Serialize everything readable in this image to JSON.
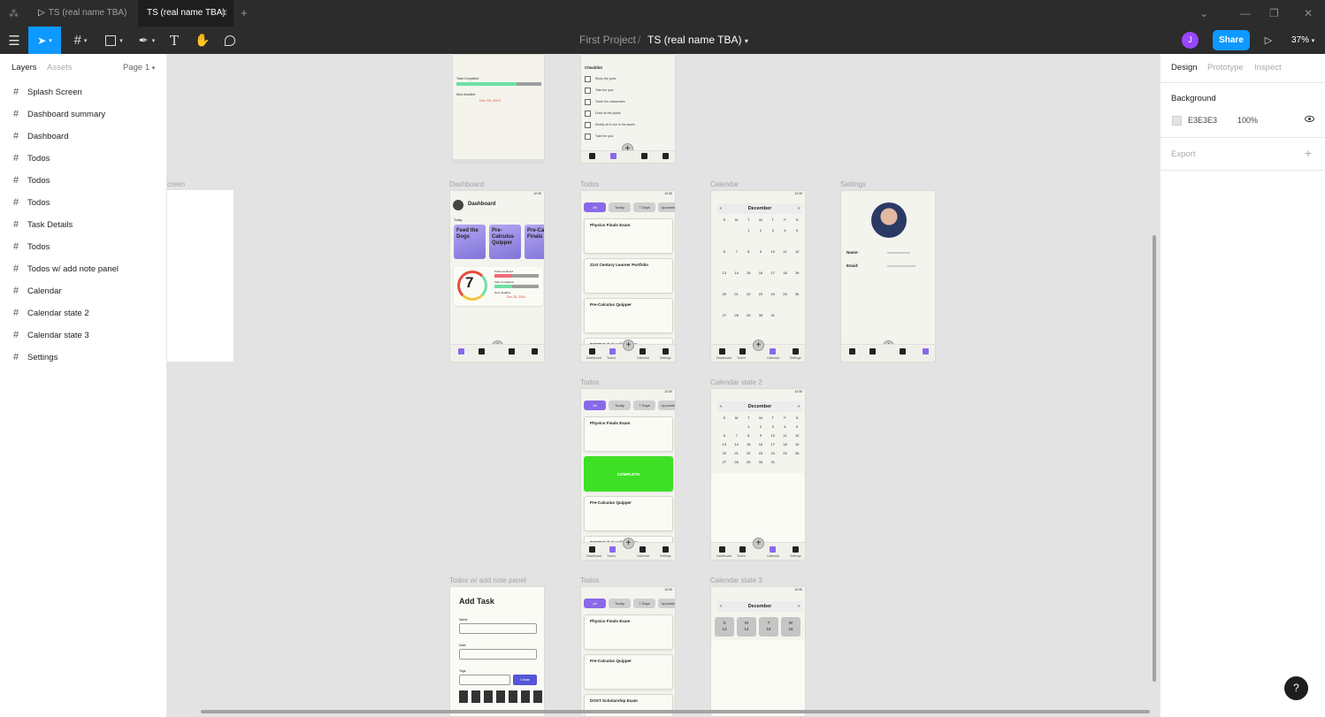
{
  "tabs": [
    {
      "label": "TS (real name TBA)",
      "icon": "play-icon"
    },
    {
      "label": "TS (real name TBA)"
    }
  ],
  "toolbar": {
    "project": "First Project",
    "separator": "/",
    "file": "TS (real name TBA)",
    "avatar_initial": "J",
    "share": "Share",
    "zoom": "37%"
  },
  "layers": {
    "tab_layers": "Layers",
    "tab_assets": "Assets",
    "page": "Page 1",
    "items": [
      "Splash Screen",
      "Dashboard summary",
      "Dashboard",
      "Todos",
      "Todos",
      "Todos",
      "Task Details",
      "Todos",
      "Todos w/ add note panel",
      "Calendar",
      "Calendar state 2",
      "Calendar state 3",
      "Settings"
    ]
  },
  "props": {
    "tabs": [
      "Design",
      "Prototype",
      "Inspect"
    ],
    "background_label": "Background",
    "bg_hex": "E3E3E3",
    "bg_opacity": "100%",
    "export_label": "Export",
    "bg_color": "#e3e3e3"
  },
  "canvas": {
    "frame_labels": {
      "screen": "creen",
      "dashboard": "Dashboard",
      "todos1": "Todos",
      "calendar": "Calendar",
      "settings": "Settings",
      "todos2": "Todos",
      "calendar2": "Calendar state 2",
      "addnote": "Todos w/ add note panel",
      "todos3": "Todos",
      "calendar3": "Calendar state 3"
    },
    "dash_summary": {
      "total": "Total Completed",
      "date": "Dec 28, 2004",
      "next": "Next deadline"
    },
    "task_details": {
      "checklist": "Checklist",
      "items": [
        "Study the gods",
        "Take the quiz",
        "Teach the classmates",
        "Drink all the plants",
        "Modify all in rice in the plants",
        "Take the quiz"
      ]
    },
    "nav": {
      "dashboard": "Dashboard",
      "todos": "Todo's",
      "calendar": "Calendar",
      "settings": "Settings"
    },
    "dashboard": {
      "title": "Dashboard",
      "today": "Today",
      "cards": [
        "Feed the Dogs",
        "Pre-Calculus Quipper",
        "Pre-Ca Finals"
      ],
      "number": "7",
      "stat1": "Total completed",
      "stat2": "Task Completed",
      "next": "Next deadline",
      "date": "Dec 28, 2004"
    },
    "todo_pills": [
      "All",
      "Today",
      "7 Days",
      "Upcoming"
    ],
    "todos1": [
      "Physics Finals Exam",
      "21st Century Learner Portfolio",
      "Pre-Calculus Quipper",
      "DOST Scholarship Exam"
    ],
    "todos2": [
      "Physics Finals Exam",
      "COMPLETE",
      "Pre-Calculus Quipper",
      "DOST Scholarship Exam"
    ],
    "todos3": [
      "Physics Finals Exam",
      "Pre-Calculus Quipper",
      "DOST Scholarship Exam"
    ],
    "calendar": {
      "month": "December",
      "prev": "‹",
      "next": "›",
      "days": [
        "S",
        "M",
        "T",
        "W",
        "T",
        "F",
        "S"
      ],
      "weeks": [
        [
          "",
          "",
          "1",
          "2",
          "3",
          "4",
          "5"
        ],
        [
          "6",
          "7",
          "8",
          "9",
          "10",
          "11",
          "12"
        ],
        [
          "13",
          "14",
          "15",
          "16",
          "17",
          "18",
          "19"
        ],
        [
          "20",
          "21",
          "22",
          "23",
          "24",
          "25",
          "26"
        ],
        [
          "27",
          "28",
          "29",
          "30",
          "31",
          "",
          ""
        ]
      ]
    },
    "calendar3_days": [
      {
        "d": "S",
        "n": "13"
      },
      {
        "d": "M",
        "n": "14"
      },
      {
        "d": "T",
        "n": "15"
      },
      {
        "d": "W",
        "n": "16"
      }
    ],
    "settings": {
      "name": "Name:",
      "email": "Email:"
    },
    "addtask": {
      "title": "Add Task",
      "name": "Name:",
      "date": "Date:",
      "tags": "Tags:",
      "create": "Create"
    },
    "status_time": "12:30"
  }
}
